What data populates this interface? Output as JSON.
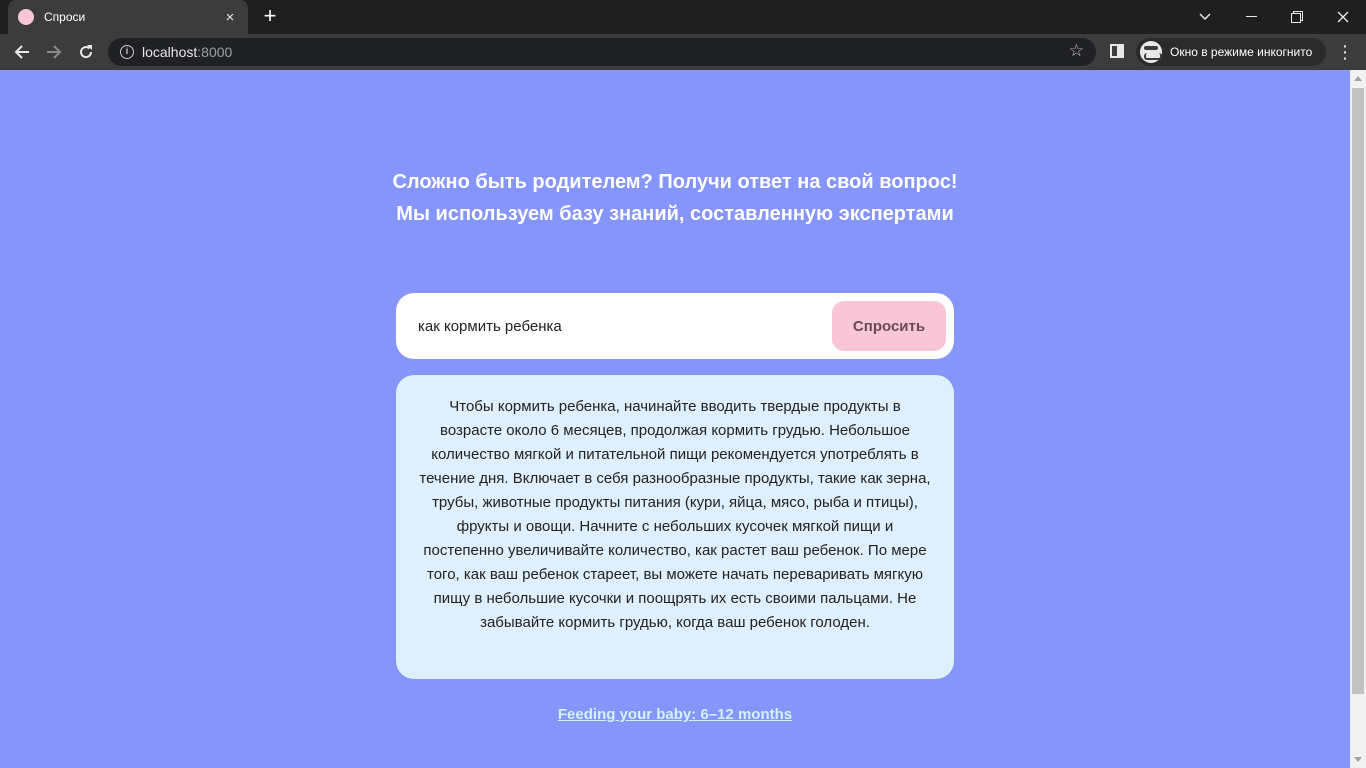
{
  "browser": {
    "tab_title": "Спроси",
    "tab_close": "×",
    "new_tab": "+",
    "url_host": "localhost",
    "url_port": ":8000",
    "incognito_label": "Окно в режиме инкогнито",
    "colors": {
      "titlebar": "#1f1f1f",
      "toolbar": "#3c3c3c",
      "favicon": "#f8c6d6"
    }
  },
  "page": {
    "headline_1": "Сложно быть родителем? Получи ответ на свой вопрос!",
    "headline_2": "Мы используем базу знаний, составленную экспертами",
    "search": {
      "value": "как кормить ребенка",
      "button_label": "Спросить"
    },
    "answer": "Чтобы кормить ребенка, начинайте вводить твердые продукты в возрасте около 6 месяцев, продолжая кормить грудью. Небольшое количество мягкой и питательной пищи рекомендуется употреблять в течение дня. Включает в себя разнообразные продукты, такие как зерна, трубы, животные продукты питания (кури, яйца, мясо, рыба и птицы), фрукты и овощи. Начните с небольших кусочек мягкой пищи и постепенно увеличивайте количество, как растет ваш ребенок. По мере того, как ваш ребенок стареет, вы можете начать переваривать мягкую пищу в небольшие кусочки и поощрять их есть своими пальцами. Не забывайте кормить грудью, когда ваш ребенок голоден.",
    "source_link": "Feeding your baby: 6–12 months",
    "colors": {
      "background": "#8595fa",
      "button": "#f8c6d6",
      "answer_card": "#deeffd",
      "link": "#d6f0ff"
    }
  }
}
